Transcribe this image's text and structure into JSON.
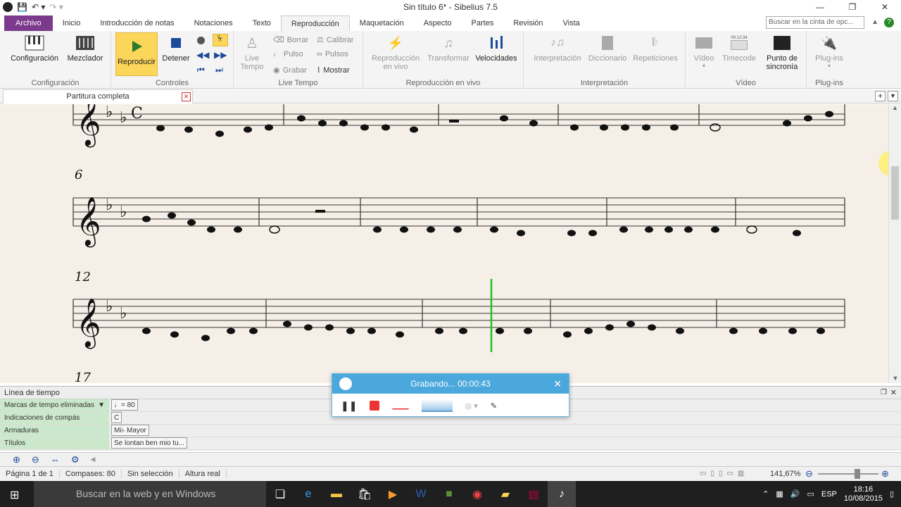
{
  "window": {
    "title": "Sin título 6* - Sibelius 7.5"
  },
  "ribbon_tabs": [
    "Archivo",
    "Inicio",
    "Introducción de notas",
    "Notaciones",
    "Texto",
    "Reproducción",
    "Maquetación",
    "Aspecto",
    "Partes",
    "Revisión",
    "Vista"
  ],
  "ribbon_search_placeholder": "Buscar en la cinta de opc...",
  "groups": {
    "config": {
      "label": "Configuración",
      "b1": "Configuración",
      "b2": "Mezclador"
    },
    "controls": {
      "label": "Controles",
      "play": "Reproducir",
      "stop": "Detener"
    },
    "livetempo": {
      "label": "Live Tempo",
      "live": "Live",
      "tempo": "Tempo",
      "borrar": "Borrar",
      "pulso": "Pulso",
      "grabar": "Grabar",
      "calibrar": "Calibrar",
      "pulsos": "Pulsos",
      "mostrar": "Mostrar"
    },
    "liveplay": {
      "label": "Reproducción en vivo",
      "b1a": "Reproducción",
      "b1b": "en vivo",
      "b2": "Transformar",
      "b3": "Velocidades"
    },
    "interp": {
      "label": "Interpretación",
      "b1": "Interpretación",
      "b2": "Diccionario",
      "b3": "Repeticiones"
    },
    "video": {
      "label": "Vídeo",
      "b1": "Vídeo",
      "b2": "Timecode",
      "b3a": "Punto de",
      "b3b": "sincronía",
      "tc": "00:12:34"
    },
    "plugins": {
      "label": "Plug-ins",
      "b1": "Plug-ins"
    }
  },
  "doc_tab": "Partitura completa",
  "score": {
    "measures": [
      "6",
      "12",
      "17"
    ]
  },
  "timeline": {
    "title": "Línea de tiempo",
    "rows": [
      {
        "label": "Marcas de tempo eliminadas",
        "value": "♩= 80"
      },
      {
        "label": "Indicaciones de compás",
        "value": "C"
      },
      {
        "label": "Armaduras",
        "value": "Mi♭ Mayor"
      },
      {
        "label": "Títulos",
        "value": "Se lontan ben mio tu..."
      }
    ]
  },
  "recorder": {
    "title": "Grabando... 00:00:43"
  },
  "status": {
    "page": "Página 1 de 1",
    "bars": "Compases: 80",
    "selection": "Sin selección",
    "pitch": "Altura real",
    "zoom": "141,67%"
  },
  "taskbar": {
    "search": "Buscar en la web y en Windows",
    "lang": "ESP",
    "time": "18:16",
    "date": "10/08/2015"
  }
}
